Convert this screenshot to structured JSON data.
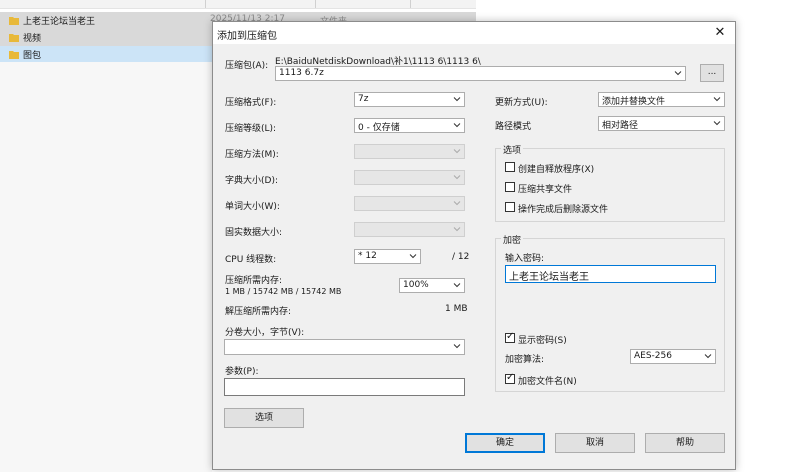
{
  "explorer": {
    "rows": [
      {
        "name": "上老王论坛当老王",
        "date": "2025/11/13 2:17",
        "type": "文件夹"
      },
      {
        "name": "视频"
      },
      {
        "name": "图包"
      }
    ]
  },
  "colors": {
    "folder": "#e8b93a",
    "selection": "#cce4f7",
    "accent": "#0078d7"
  },
  "dialog": {
    "title": "添加到压缩包",
    "close_icon": "close-icon",
    "archive_label": "压缩包(A):",
    "archive_path": "E:\\BaiduNetdiskDownload\\补1\\1113 6\\1113 6\\",
    "archive_name": "1113 6.7z",
    "browse_label": "...",
    "format_label": "压缩格式(F):",
    "format_value": "7z",
    "level_label": "压缩等级(L):",
    "level_value": "0 - 仅存储",
    "method_label": "压缩方法(M):",
    "dict_label": "字典大小(D):",
    "word_label": "单词大小(W):",
    "solid_label": "固实数据大小:",
    "threads_label": "CPU 线程数:",
    "threads_value": "* 12",
    "threads_max": "/ 12",
    "mem_compress_label": "压缩所需内存:",
    "mem_compress_value": "1 MB / 15742 MB / 15742 MB",
    "mem_percent": "100%",
    "mem_decompress_label": "解压缩所需内存:",
    "mem_decompress_value": "1 MB",
    "volume_label": "分卷大小，字节(V):",
    "volume_value": "",
    "params_label": "参数(P):",
    "params_value": "",
    "options_button": "选项",
    "update_label": "更新方式(U):",
    "update_value": "添加并替换文件",
    "path_label": "路径模式",
    "path_value": "相对路径",
    "options_group": "选项",
    "opt_sfx": "创建自释放程序(X)",
    "opt_shared": "压缩共享文件",
    "opt_delete": "操作完成后删除源文件",
    "enc_group": "加密",
    "enc_pwd_label": "输入密码:",
    "enc_pwd_value": "上老王论坛当老王",
    "show_pwd_label": "显示密码(S)",
    "enc_method_label": "加密算法:",
    "enc_method_value": "AES-256",
    "enc_names_label": "加密文件名(N)",
    "ok": "确定",
    "cancel": "取消",
    "help": "帮助"
  }
}
